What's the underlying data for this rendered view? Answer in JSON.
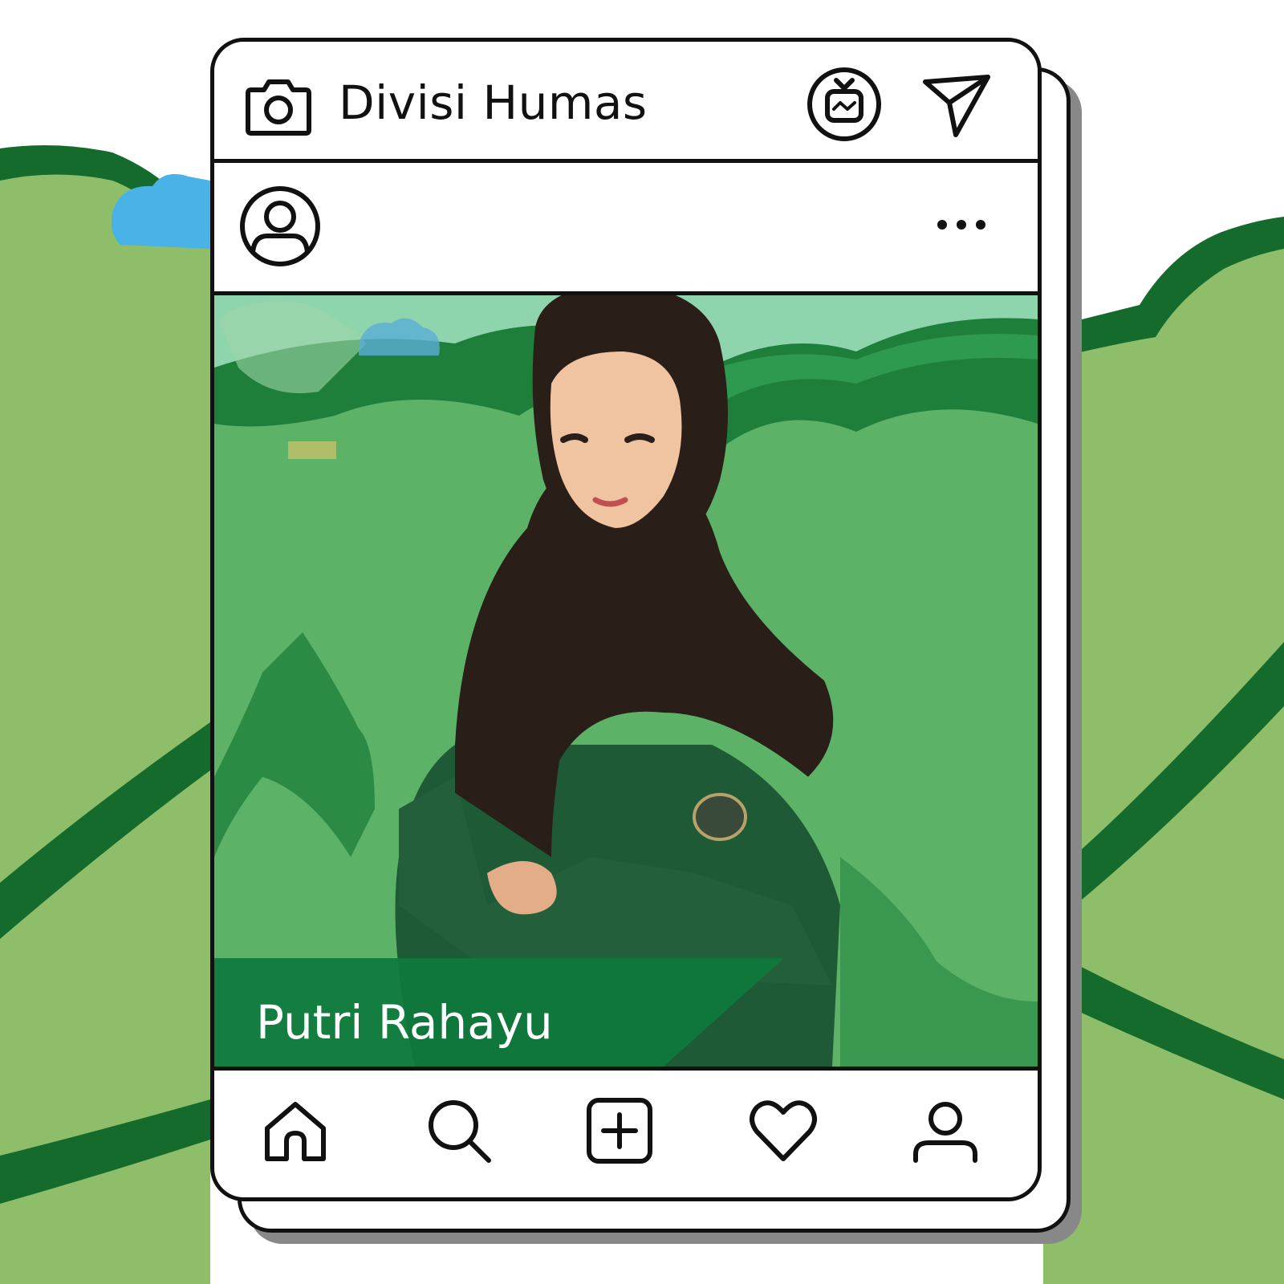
{
  "header": {
    "title": "Divisi Humas"
  },
  "post": {
    "caption": "Putri Rahayu"
  },
  "icons": {
    "camera": "camera-icon",
    "igtv": "igtv-icon",
    "send": "send-icon",
    "avatar": "avatar-icon",
    "more": "more-options-icon",
    "nav": [
      "home-icon",
      "search-icon",
      "add-post-icon",
      "heart-icon",
      "profile-icon"
    ]
  },
  "colors": {
    "background_green": "#8fbe6a",
    "mountain_dark": "#156b2c",
    "photo_green": "#5cb368",
    "caption_band": "#0e7a3d",
    "outline": "#111111"
  }
}
